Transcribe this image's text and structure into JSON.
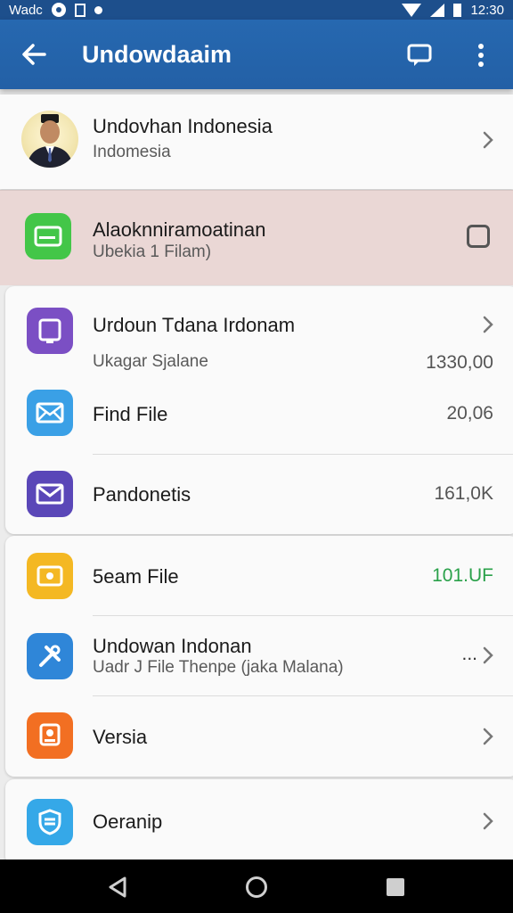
{
  "status_bar": {
    "left_text": "Wadc",
    "time": "12:30"
  },
  "app_bar": {
    "title": "Undowdaaim"
  },
  "profile": {
    "name": "Undovhan Indonesia",
    "subtitle": "Indomesia"
  },
  "highlight_item": {
    "title": "Alaoknniramoatinan",
    "subtitle": "Ubekia 1 Filam)",
    "highlight_color": "#ead7d5",
    "icon": "wallet-icon",
    "icon_color": "#43c648"
  },
  "card1": {
    "items": [
      {
        "title": "Urdoun Tdana Irdonam",
        "subtitle": "Ukagar Sjalane",
        "value": "1330,00",
        "icon": "tablet-icon",
        "icon_color": "#7b4fc4"
      },
      {
        "title": "Find File",
        "value": "20,06",
        "icon": "mail-icon",
        "icon_color": "#3aa0e6"
      },
      {
        "title": "Pandonetis",
        "value": "161,0K",
        "icon": "envelope-icon",
        "icon_color": "#5a47b8"
      }
    ]
  },
  "card2": {
    "items": [
      {
        "title": "5eam File",
        "value": "101.UF",
        "value_color": "#2aa14a",
        "icon": "camera-icon",
        "icon_color": "#f4b823"
      },
      {
        "title": "Undowan Indonan",
        "subtitle": "Uadr J File Thenpe (jaka Malana)",
        "value": "...",
        "icon": "tools-icon",
        "icon_color": "#2f86d8"
      },
      {
        "title": "Versia",
        "icon": "badge-icon",
        "icon_color": "#f26f22"
      }
    ]
  },
  "card3": {
    "items": [
      {
        "title": "Oeranip",
        "icon": "shield-icon",
        "icon_color": "#35a8e8"
      }
    ]
  }
}
